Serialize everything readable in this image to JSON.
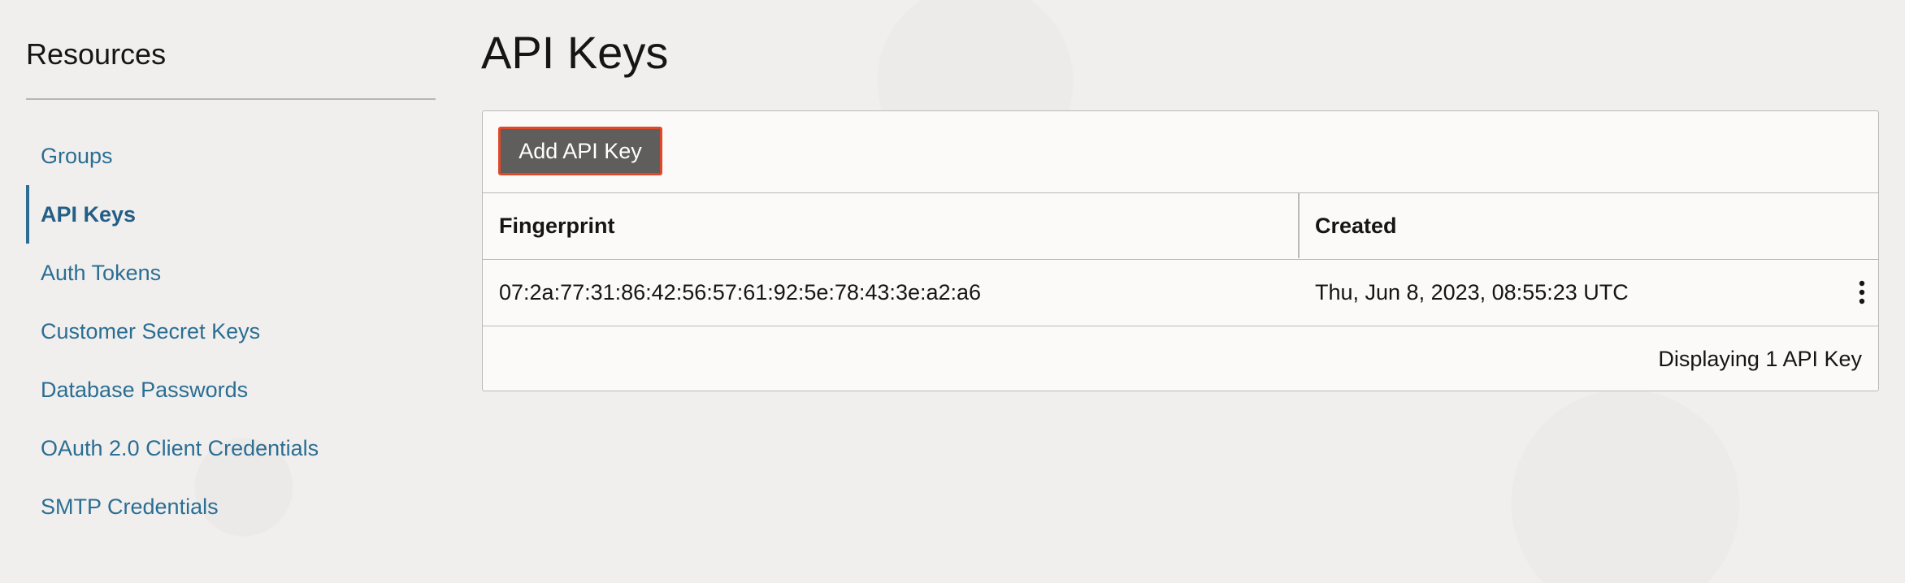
{
  "sidebar": {
    "title": "Resources",
    "items": [
      {
        "label": "Groups",
        "active": false
      },
      {
        "label": "API Keys",
        "active": true
      },
      {
        "label": "Auth Tokens",
        "active": false
      },
      {
        "label": "Customer Secret Keys",
        "active": false
      },
      {
        "label": "Database Passwords",
        "active": false
      },
      {
        "label": "OAuth 2.0 Client Credentials",
        "active": false
      },
      {
        "label": "SMTP Credentials",
        "active": false
      }
    ]
  },
  "main": {
    "title": "API Keys",
    "add_button_label": "Add API Key",
    "table": {
      "columns": [
        "Fingerprint",
        "Created"
      ],
      "rows": [
        {
          "fingerprint": "07:2a:77:31:86:42:56:57:61:92:5e:78:43:3e:a2:a6",
          "created": "Thu, Jun 8, 2023, 08:55:23 UTC",
          "actions_icon": "kebab-menu-icon"
        }
      ],
      "footer": "Displaying 1 API Key"
    }
  },
  "colors": {
    "link": "#2a6e94",
    "button_bg": "#5f5e5c",
    "button_highlight_border": "#e0482a",
    "page_bg": "#f1efed",
    "panel_bg": "#fbfaf8"
  }
}
